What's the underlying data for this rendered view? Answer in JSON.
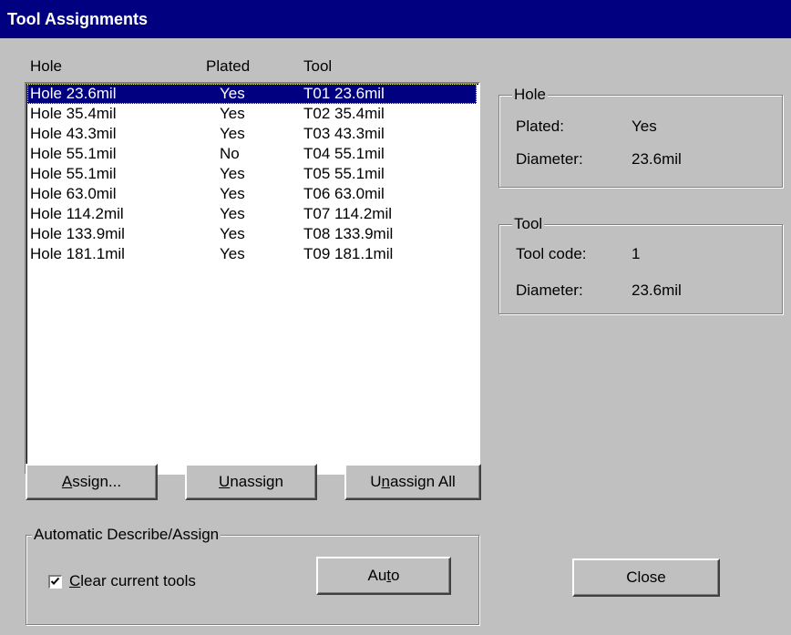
{
  "window": {
    "title": "Tool Assignments"
  },
  "columns": {
    "hole": "Hole",
    "plated": "Plated",
    "tool": "Tool"
  },
  "rows": [
    {
      "hole": "Hole 23.6mil",
      "plated": "Yes",
      "tool": "T01 23.6mil",
      "selected": true
    },
    {
      "hole": "Hole 35.4mil",
      "plated": "Yes",
      "tool": "T02 35.4mil"
    },
    {
      "hole": "Hole 43.3mil",
      "plated": "Yes",
      "tool": "T03 43.3mil"
    },
    {
      "hole": "Hole 55.1mil",
      "plated": "No",
      "tool": "T04 55.1mil"
    },
    {
      "hole": "Hole 55.1mil",
      "plated": "Yes",
      "tool": "T05 55.1mil"
    },
    {
      "hole": "Hole 63.0mil",
      "plated": "Yes",
      "tool": "T06 63.0mil"
    },
    {
      "hole": "Hole 114.2mil",
      "plated": "Yes",
      "tool": "T07 114.2mil"
    },
    {
      "hole": "Hole 133.9mil",
      "plated": "Yes",
      "tool": "T08 133.9mil"
    },
    {
      "hole": "Hole 181.1mil",
      "plated": "Yes",
      "tool": "T09 181.1mil"
    }
  ],
  "hole_group": {
    "title": "Hole",
    "plated_label": "Plated:",
    "plated_value": "Yes",
    "diameter_label": "Diameter:",
    "diameter_value": "23.6mil"
  },
  "tool_group": {
    "title": "Tool",
    "code_label": "Tool code:",
    "code_value": "1",
    "diameter_label": "Diameter:",
    "diameter_value": "23.6mil"
  },
  "buttons": {
    "assign": {
      "accel": "A",
      "rest": "ssign..."
    },
    "unassign": {
      "accel": "U",
      "rest": "nassign"
    },
    "unassign_all": {
      "pre": "U",
      "accel": "n",
      "rest": "assign All"
    },
    "auto": {
      "pre": "Au",
      "accel": "t",
      "rest": "o"
    },
    "close": "Close"
  },
  "auto_group": {
    "title": "Automatic Describe/Assign",
    "checkbox": {
      "accel": "C",
      "rest": "lear current tools",
      "checked": true
    }
  },
  "colors": {
    "title_bg": "#000080",
    "face": "#c0c0c0",
    "selection": "#000080"
  }
}
